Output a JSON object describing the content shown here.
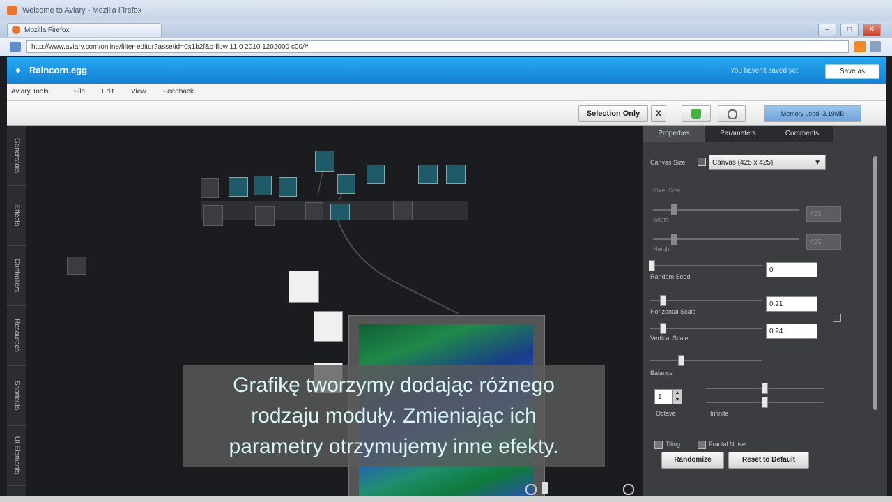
{
  "window": {
    "title": "Welcome to Aviary - Mozilla Firefox",
    "tab_label": "Mozilla Firefox",
    "url": "http://www.aviary.com/online/filter-editor?assetid=0x1b2f&c-flow 11.0 2010 1202000 c00/#"
  },
  "app": {
    "file_title": "Raincorn.egg",
    "saved_message": "You haven't saved yet",
    "save_button": "Save as"
  },
  "menu": [
    "Aviary Tools",
    "File",
    "Edit",
    "View",
    "Feedback"
  ],
  "toolbar": {
    "selection_only": "Selection Only",
    "x_button": "X",
    "memory_label": "Memory used: 3.19MB"
  },
  "left_tabs": [
    "Generators",
    "Effects",
    "Controllers",
    "Resources",
    "Shortcuts",
    "UI Elements"
  ],
  "panel": {
    "tabs": [
      "Properties",
      "Parameters",
      "Comments"
    ],
    "canvas_size_label": "Canvas Size",
    "canvas_size_value": "Canvas (425 x 425)",
    "pixel_size_label": "Pixel Size",
    "width_label": "Width",
    "width_value": "425",
    "height_label": "Height",
    "height_value": "425",
    "random_seed_label": "Random Seed",
    "random_seed_value": "0",
    "h_scale_label": "Horizontal Scale",
    "h_scale_value": "0.21",
    "v_scale_label": "Vertical Scale",
    "v_scale_value": "0.24",
    "octave_label": "Octave",
    "octave_value": "1",
    "balance_label": "Balance",
    "infinite_label": "Infinite",
    "tiling_label": "Tiling",
    "fractal_label": "Fractal Noise",
    "randomize_button": "Randomize",
    "reset_button": "Reset to Default"
  },
  "caption": {
    "line1": "Grafikę tworzymy dodając różnego",
    "line2": "rodzaju moduły. Zmieniając ich",
    "line3": "parametry otrzymujemy inne efekty."
  }
}
